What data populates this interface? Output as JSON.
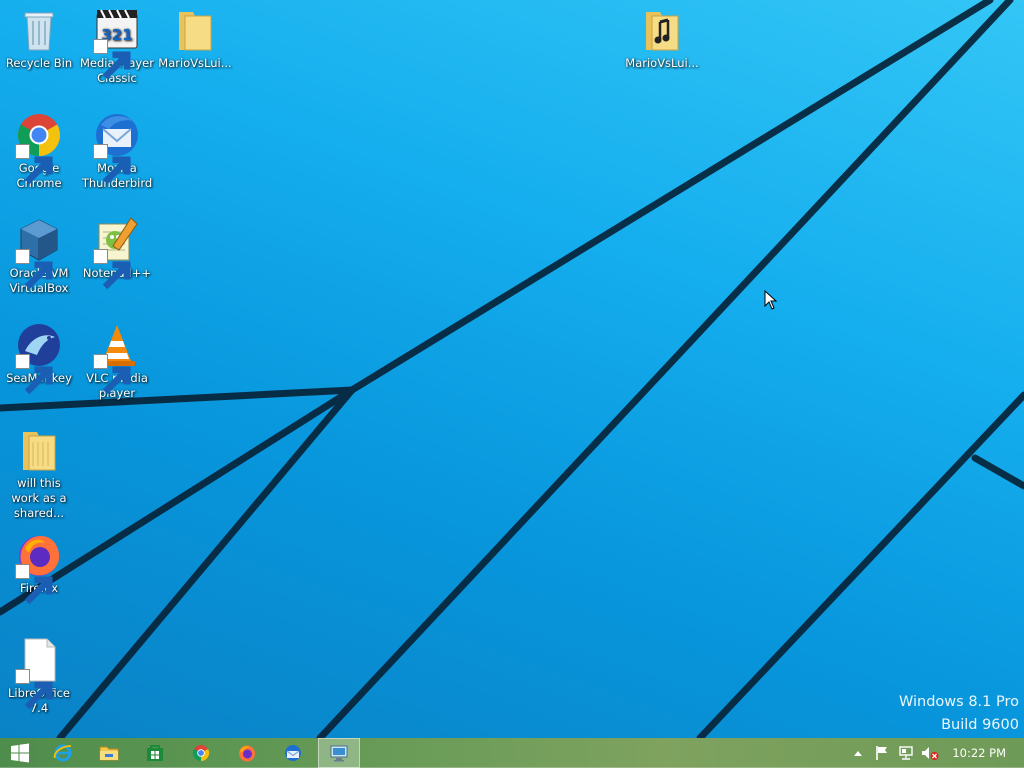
{
  "desktop": {
    "icons": [
      {
        "label": "Recycle Bin",
        "icon": "recycle-bin-icon"
      },
      {
        "label": "Media Player Classic",
        "icon": "media-player-classic-icon"
      },
      {
        "label": "MarioVsLui...",
        "icon": "folder-icon"
      },
      {
        "label": "MarioVsLui...",
        "icon": "audio-folder-icon"
      },
      {
        "label": "Google Chrome",
        "icon": "chrome-icon"
      },
      {
        "label": "Mozilla Thunderbird",
        "icon": "thunderbird-icon"
      },
      {
        "label": "Oracle VM VirtualBox",
        "icon": "virtualbox-icon"
      },
      {
        "label": "Notepad++",
        "icon": "notepad-plus-plus-icon"
      },
      {
        "label": "SeaMonkey",
        "icon": "seamonkey-icon"
      },
      {
        "label": "VLC media player",
        "icon": "vlc-icon"
      },
      {
        "label": "will this work as a shared...",
        "icon": "folder-icon"
      },
      {
        "label": "Firefox",
        "icon": "firefox-icon"
      },
      {
        "label": "LibreOffice 7.4",
        "icon": "libreoffice-icon"
      }
    ]
  },
  "watermark": {
    "line1": "Windows 8.1 Pro",
    "line2": "Build 9600"
  },
  "taskbar": {
    "start": "windows-logo-icon",
    "pinned": [
      {
        "name": "Internet Explorer",
        "icon": "internet-explorer-icon"
      },
      {
        "name": "File Explorer",
        "icon": "file-explorer-icon"
      },
      {
        "name": "Store",
        "icon": "store-icon"
      },
      {
        "name": "Google Chrome",
        "icon": "chrome-icon"
      },
      {
        "name": "Firefox",
        "icon": "firefox-icon"
      },
      {
        "name": "Thunderbird",
        "icon": "thunderbird-icon"
      },
      {
        "name": "Remote Desktop",
        "icon": "remote-desktop-icon",
        "active": true
      }
    ],
    "tray": [
      "show-hidden-icons-icon",
      "action-center-flag-icon",
      "network-icon",
      "volume-muted-icon"
    ],
    "clock": "10:22 PM"
  },
  "colors": {
    "desktop": "#0a9ae0",
    "taskbar": "#6a9c58"
  }
}
